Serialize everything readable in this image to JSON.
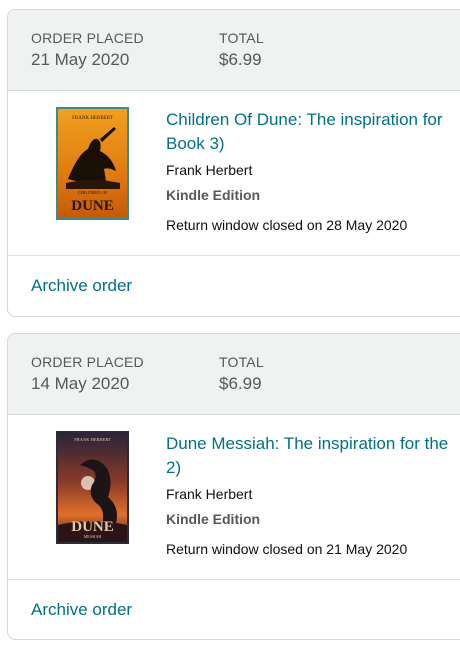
{
  "orders": [
    {
      "placed_label": "ORDER PLACED",
      "placed_date": "21 May 2020",
      "total_label": "TOTAL",
      "total_value": "$6.99",
      "item": {
        "title_line1": "Children Of Dune: The inspiration for",
        "title_line2": "Book 3)",
        "author": "Frank Herbert",
        "format": "Kindle Edition",
        "return_status": "Return window closed on 28 May 2020",
        "cover_author_text": "FRANK HERBERT",
        "cover_subtitle_text": "CHILDREN OF",
        "cover_title_text": "DUNE"
      },
      "archive_label": "Archive order"
    },
    {
      "placed_label": "ORDER PLACED",
      "placed_date": "14 May 2020",
      "total_label": "TOTAL",
      "total_value": "$6.99",
      "item": {
        "title_line1": "Dune Messiah: The inspiration for the",
        "title_line2": "2)",
        "author": "Frank Herbert",
        "format": "Kindle Edition",
        "return_status": "Return window closed on 21 May 2020",
        "cover_author_text": "FRANK HERBERT",
        "cover_title_text": "DUNE",
        "cover_subtitle_text": "MESSIAH"
      },
      "archive_label": "Archive order"
    }
  ],
  "colors": {
    "link": "#007185",
    "header_bg": "#f0f2f2",
    "border": "#d5d9d9"
  }
}
